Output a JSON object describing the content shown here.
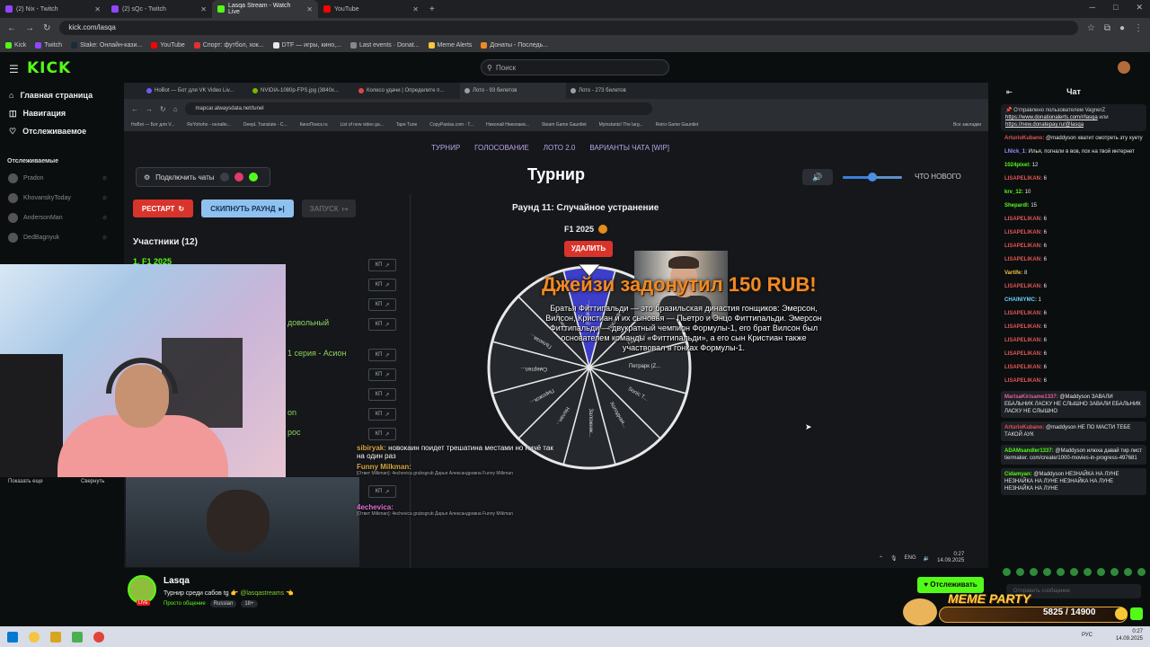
{
  "browser": {
    "tabs": [
      {
        "label": "(2) Nix - Twitch",
        "color": "#9146ff"
      },
      {
        "label": "(2) sQc - Twitch",
        "color": "#9146ff"
      },
      {
        "label": "Lasqa Stream - Watch Live",
        "color": "#53fc18"
      },
      {
        "label": "YouTube",
        "color": "#ff0000"
      }
    ],
    "url": "kick.com/lasqa",
    "bookmarks": [
      "Kick",
      "Twitch",
      "Stake: Онлайн-кази...",
      "YouTube",
      "Спорт: футбол, хок...",
      "DTF — игры, кино,...",
      "Last events · Donat...",
      "Meme Alerts",
      "Донаты - Последь..."
    ]
  },
  "kick": {
    "logo": "KICK",
    "search_placeholder": "Поиск",
    "nav": [
      {
        "label": "Главная страница",
        "icon": "home-icon"
      },
      {
        "label": "Навигация",
        "icon": "compass-icon"
      },
      {
        "label": "Отслеживаемое",
        "icon": "heart-icon"
      }
    ],
    "following_title": "Отслеживаемые",
    "following": [
      "Pradon",
      "KhovanskyToday",
      "AndersonMan",
      "DedBagnyuk"
    ],
    "show_more": "Показать еще",
    "collapse": "Свернуть"
  },
  "inner": {
    "tabs": [
      "HoBot — Бот для VK Video Liv...",
      "NVIDIA-1080p-FPS.jpg (3840x...",
      "Колесо удачи | Определите п...",
      "Лото - 93 билетов",
      "Лото - 273 билетов"
    ],
    "url": "mapcar.alwaysdata.net/tunel",
    "bookmarks": [
      "HoBot — Бот для V...",
      "ReYohoho - онлайн...",
      "DeepL Translate - C...",
      "КиноПоиск.ru",
      "List of new video ga...",
      "Tape Tune",
      "CopyPastas.com - T...",
      "Николай Николаев...",
      "Steam Game Gauntlet",
      "Myinstants! The larg...",
      "Retro Game Gauntlet",
      "Все закладки"
    ],
    "topnav": [
      "ТУРНИР",
      "ГОЛОСОВАНИЕ",
      "ЛОТО 2.0",
      "ВАРИАНТЫ ЧАТА [WIP]"
    ],
    "title": "Турнир",
    "connect_label": "Подключить чаты",
    "whats_new": "ЧТО НОВОГО",
    "volume_level": 0.5,
    "restart": "РЕСТАРТ",
    "skip_round": "СКИПНУТЬ РАУНД",
    "launch": "ЗАПУСК",
    "participants_title": "Участники (12)",
    "participant_first": "1. F1 2025",
    "participant_fragments": [
      "довольный",
      "1 серия - Асион",
      "on",
      "рос"
    ],
    "kp_label": "КП",
    "round_title": "Раунд 11: Случайное устранение",
    "current": "F1 2025",
    "delete": "УДАЛИТЬ",
    "wheel_labels": [
      "(Обзорн...",
      "Последн...",
      "Петро...",
      "Петрарк (Z...",
      "Sonic T...",
      "Холодная...",
      "Заложник...",
      "Нолан...",
      "Пирожок...",
      "Смертел...",
      "Галкоза...",
      "Пиксел..."
    ]
  },
  "donation": {
    "headline": "Джейзи задонутил 150 RUB!",
    "message": "Братья Фиттипальди — это бразильская династия гонщиков: Эмерсон, Вилсон, Кристиан и их сыновья — Пьетро и Энцо Фиттипальди. Эмерсон Фиттипальди — двукратный чемпион Формулы-1, его брат Вилсон был основателем команды «Фиттипальди», а его сын Кристиан также участвовал в гонках Формулы-1."
  },
  "stream_chat_overlay": [
    {
      "user": "sibiryak:",
      "text": "новокаин поидет трешатина местами но ничё так на один раз"
    },
    {
      "user": "Funny Milkman:",
      "text": "",
      "meta": "[Ответ Milkman]: 4echevica grubsgrub Дарья Александровна Funny Milkman"
    },
    {
      "user": "4echevica:",
      "text": "",
      "meta": "[Ответ Milkman]: 4echevica grubsgrub Дарья Александровна Funny Milkman"
    }
  ],
  "os_overlay": {
    "lang": "ENG",
    "time": "0:27",
    "date": "14.09.2025"
  },
  "chat": {
    "title": "Чат",
    "pinned_prefix": "Отправлено пользователем",
    "pinned_user": "VagnerZ",
    "pinned_link1": "https://www.donationalerts.com/r/lasqa",
    "pinned_mid": "или",
    "pinned_link2": "https://new.donatepay.ru/@lasqa",
    "messages": [
      {
        "user": "ArturioKubano:",
        "color": "#e05555",
        "text": "@maddyson хватит смотреть эту хуету"
      },
      {
        "user": "LNick_1:",
        "color": "#9b8cff",
        "text": "Илья, погнали в вов, пох на твой интернет"
      },
      {
        "user": "1024pixel:",
        "color": "#53fc18",
        "text": "12"
      },
      {
        "user": "LISAPELIKAN:",
        "color": "#e05555",
        "text": "6"
      },
      {
        "user": "krv_12:",
        "color": "#53fc18",
        "text": "10"
      },
      {
        "user": "Shepardl:",
        "color": "#53fc18",
        "text": "15"
      },
      {
        "user": "LISAPELIKAN:",
        "color": "#e05555",
        "text": "6"
      },
      {
        "user": "LISAPELIKAN:",
        "color": "#e05555",
        "text": "6"
      },
      {
        "user": "LISAPELIKAN:",
        "color": "#e05555",
        "text": "6"
      },
      {
        "user": "LISAPELIKAN:",
        "color": "#e05555",
        "text": "6"
      },
      {
        "user": "Vartife:",
        "color": "#f0c040",
        "text": "8"
      },
      {
        "user": "LISAPELIKAN:",
        "color": "#e05555",
        "text": "6"
      },
      {
        "user": "CHAINIYMC:",
        "color": "#6ad0ff",
        "text": "1"
      },
      {
        "user": "LISAPELIKAN:",
        "color": "#e05555",
        "text": "6"
      },
      {
        "user": "LISAPELIKAN:",
        "color": "#e05555",
        "text": "6"
      },
      {
        "user": "LISAPELIKAN:",
        "color": "#e05555",
        "text": "6"
      },
      {
        "user": "LISAPELIKAN:",
        "color": "#e05555",
        "text": "6"
      },
      {
        "user": "LISAPELIKAN:",
        "color": "#e05555",
        "text": "6"
      },
      {
        "user": "LISAPELIKAN:",
        "color": "#e05555",
        "text": "6"
      }
    ],
    "highlighted": [
      {
        "user": "MarisaKirisame1337:",
        "color": "#e05fa0",
        "text": "@Maddyson ЗАВАЛИ ЕБАЛЬНИК ЛАСКУ НЕ СЛЫШНО ЗАВАЛИ ЕБАЛЬНИК ЛАСКУ НЕ СЛЫШНО"
      },
      {
        "user": "ArturioKubano:",
        "color": "#e05555",
        "text": "@maddyson НЕ ПО МАСТИ ТЕБЕ ТАКОЙ АУК"
      },
      {
        "user": "ADAMsandler1337:",
        "color": "#53fc18",
        "text": "@Maddyson илюха давай тир лист tiermaker. com/create/1000-movies-in-progress-497681"
      },
      {
        "user": "Cidamyan:",
        "color": "#53fc18",
        "text": "@Maddyson НЕЗНАЙКА НА ЛУНЕ НЕЗНАЙКА НА ЛУНЕ НЕЗНАЙКА НА ЛУНЕ НЕЗНАЙКА НА ЛУНЕ"
      }
    ],
    "input_placeholder": "Отправить сообщение"
  },
  "channel": {
    "name": "Lasqa",
    "title_prefix": "Турнир среди сабов",
    "title_tg": "tg",
    "title_handle": "@lasqastreams",
    "category": "Просто общение",
    "tags": [
      "Russian",
      "18+"
    ],
    "follow": "Отслеживать",
    "live_badge": "LIVE"
  },
  "meme_party": {
    "title": "MEME PARTY",
    "score": "5825 / 14900"
  },
  "taskbar": {
    "lang": "РУС",
    "time": "0:27",
    "date": "14.09.2025"
  },
  "colors": {
    "kick_green": "#53fc18",
    "accent_red": "#d9342b",
    "skip_blue": "#8fc1ee",
    "wheel_blue": "#3d3ec9"
  }
}
